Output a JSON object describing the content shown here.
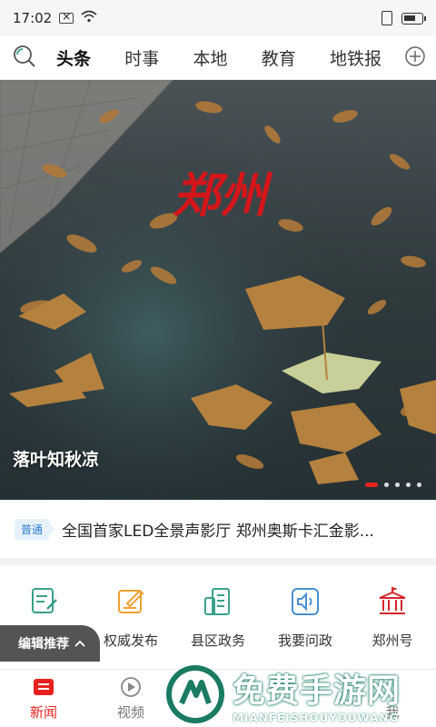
{
  "status_bar": {
    "time": "17:02"
  },
  "tabs": {
    "items": [
      {
        "label": "头条",
        "active": true
      },
      {
        "label": "时事"
      },
      {
        "label": "本地"
      },
      {
        "label": "教育"
      },
      {
        "label": "地铁报"
      }
    ]
  },
  "hero": {
    "logo_text": "郑州",
    "caption": "落叶知秋凉",
    "slides_count": 5,
    "active_slide": 1
  },
  "ticker": {
    "badge": "普通",
    "text": "全国首家LED全景声影厅 郑州奥斯卡汇金影..."
  },
  "quick_access": [
    {
      "label": ""
    },
    {
      "label": "权威发布"
    },
    {
      "label": "县区政务"
    },
    {
      "label": "我要问政"
    },
    {
      "label": "郑州号"
    }
  ],
  "editor_pick": {
    "label": "编辑推荐"
  },
  "bottom_nav": [
    {
      "label": "新闻",
      "active": true
    },
    {
      "label": "视频"
    },
    {
      "label": ""
    },
    {
      "label": ""
    },
    {
      "label": "我"
    }
  ],
  "watermark": {
    "title": "免费手游网",
    "subtitle": "MIANFEISHOUYOUWANG"
  },
  "colors": {
    "accent": "#e8231f",
    "icon_green": "#3aa08a",
    "icon_orange": "#f0a030",
    "icon_blue": "#4a8fd0"
  }
}
